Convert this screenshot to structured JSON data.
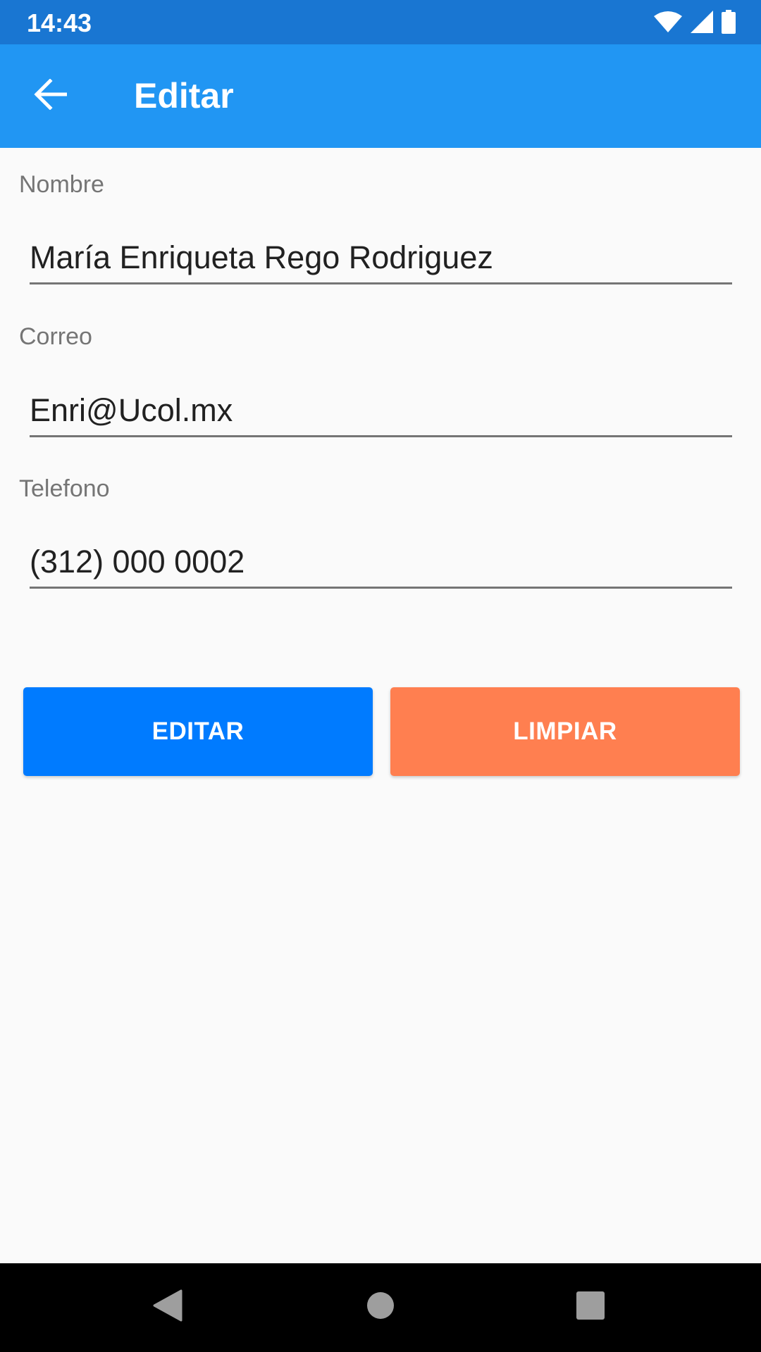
{
  "status_bar": {
    "time": "14:43",
    "icons": [
      "wifi-icon",
      "cellular-signal-icon",
      "battery-icon"
    ]
  },
  "app_bar": {
    "title": "Editar",
    "back_icon": "arrow-back-icon",
    "color": "#2196F3"
  },
  "form": {
    "name": {
      "label": "Nombre",
      "value": "María Enriqueta Rego Rodriguez"
    },
    "email": {
      "label": "Correo",
      "value": "Enri@Ucol.mx"
    },
    "phone": {
      "label": "Telefono",
      "value": "(312) 000 0002"
    }
  },
  "buttons": {
    "edit": {
      "label": "EDITAR",
      "color": "#007BFF"
    },
    "clear": {
      "label": "LIMPIAR",
      "color": "#FF7F50"
    }
  },
  "nav_bar": {
    "icons": [
      "nav-back-icon",
      "nav-home-icon",
      "nav-recents-icon"
    ]
  }
}
